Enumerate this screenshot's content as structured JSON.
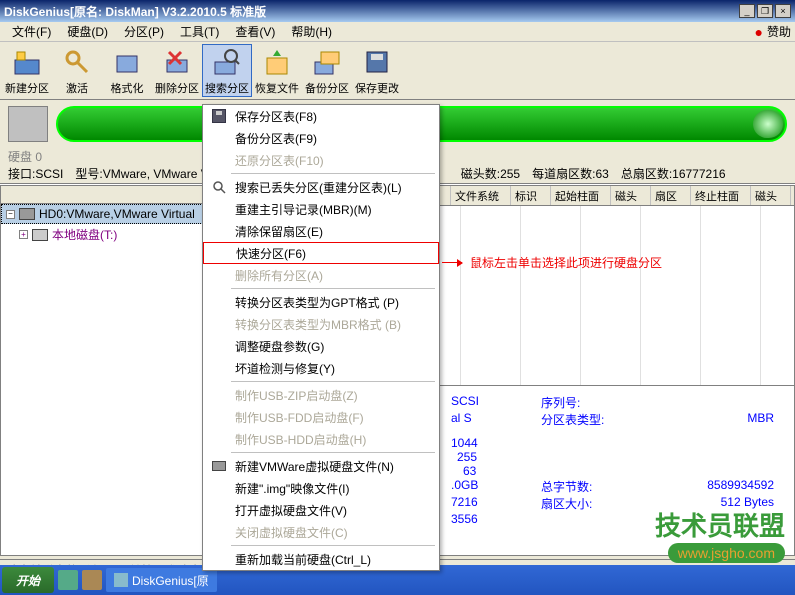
{
  "window": {
    "title": "DiskGenius[原名: DiskMan] V3.2.2010.5 标准版",
    "min": "_",
    "restore": "❐",
    "close": "×"
  },
  "menubar": {
    "file": "文件(F)",
    "disk": "硬盘(D)",
    "partition": "分区(P)",
    "tools": "工具(T)",
    "view": "查看(V)",
    "help": "帮助(H)",
    "sponsor": "赞助"
  },
  "toolbar": {
    "new_partition": "新建分区",
    "activate": "激活",
    "format": "格式化",
    "delete_partition": "删除分区",
    "search_partition": "搜索分区",
    "recover_files": "恢复文件",
    "backup_partition": "备份分区",
    "save_changes": "保存更改"
  },
  "disk_label": "硬盘 0",
  "info": {
    "interface_label": "接口:",
    "interface": "SCSI",
    "model_label": "型号:",
    "model": "VMware, VMware V",
    "heads_label": "磁头数:",
    "heads": "255",
    "sectors_label": "每道扇区数:",
    "sectors": "63",
    "total_sectors_label": "总扇区数:",
    "total_sectors": "16777216"
  },
  "tree": {
    "hd0": "HD0:VMware,VMware Virtual",
    "local_disk": "本地磁盘(T:)"
  },
  "table_headers": [
    "文件系统",
    "标识",
    "起始柱面",
    "磁头",
    "扇区",
    "终止柱面",
    "磁头"
  ],
  "details": {
    "scsi": "SCSI",
    "serial_label": "序列号:",
    "al_s": "al S",
    "ptable_label": "分区表类型:",
    "ptable": "MBR",
    "v1": "1044",
    "v2": "255",
    "v3": "63",
    "size": ".0GB",
    "total_bytes_label": "总字节数:",
    "total_bytes": "8589934592",
    "v4": "7216",
    "sector_size_label": "扇区大小:",
    "sector_size": "512 Bytes",
    "v5": "3556"
  },
  "context_menu": {
    "save_table": "保存分区表(F8)",
    "backup_table": "备份分区表(F9)",
    "restore_table": "还原分区表(F10)",
    "search_lost": "搜索已丢失分区(重建分区表)(L)",
    "rebuild_mbr": "重建主引导记录(MBR)(M)",
    "clear_reserved": "清除保留扇区(E)",
    "quick_partition": "快速分区(F6)",
    "delete_all": "删除所有分区(A)",
    "to_gpt": "转换分区表类型为GPT格式 (P)",
    "to_mbr": "转换分区表类型为MBR格式 (B)",
    "adjust_params": "调整硬盘参数(G)",
    "bad_track": "坏道检测与修复(Y)",
    "usb_zip": "制作USB-ZIP启动盘(Z)",
    "usb_fdd": "制作USB-FDD启动盘(F)",
    "usb_hdd": "制作USB-HDD启动盘(H)",
    "new_vmware": "新建VMWare虚拟硬盘文件(N)",
    "new_img": "新建\".img\"映像文件(I)",
    "open_vdisk": "打开虚拟硬盘文件(V)",
    "close_vdisk": "关闭虚拟硬盘文件(C)",
    "reload": "重新加载当前硬盘(Ctrl_L)"
  },
  "annotation": "鼠标左击单击选择此项进行硬盘分区",
  "statusbar": "除当前磁盘的所有分区,并按要求建立",
  "taskbar": {
    "start": "开始",
    "app": "DiskGenius[原"
  },
  "watermark": {
    "top": "技术员联盟",
    "bottom": "www.jsgho.com"
  }
}
